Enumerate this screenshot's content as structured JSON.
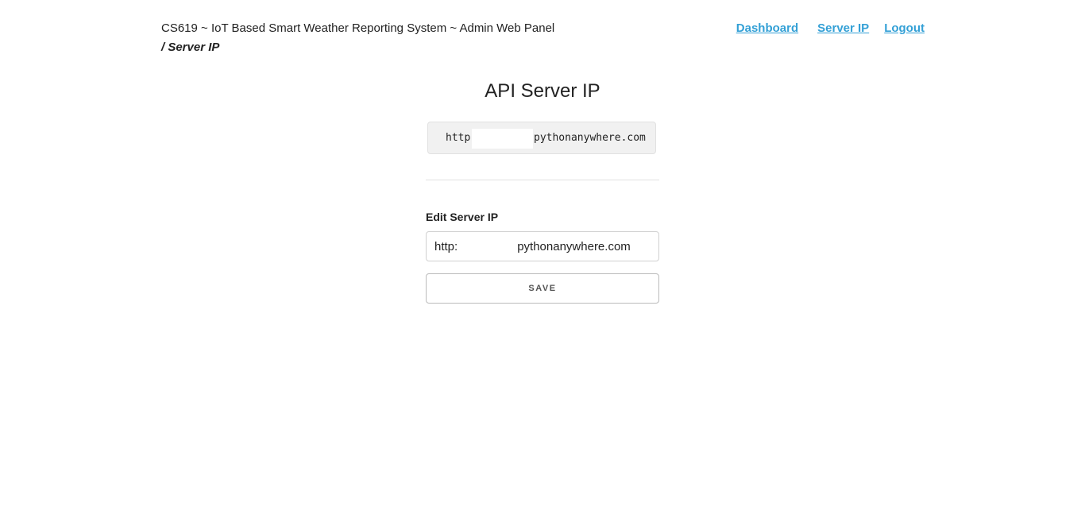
{
  "header": {
    "site_title": "CS619 ~ IoT Based Smart Weather Reporting System ~ Admin Web Panel",
    "breadcrumb": "/ Server IP",
    "nav": {
      "dashboard": "Dashboard",
      "server_ip": "Server IP",
      "logout": "Logout"
    },
    "link_color": "#33a0d6"
  },
  "main": {
    "title": "API Server IP",
    "current_ip": {
      "prefix": "http",
      "suffix": "pythonanywhere.com"
    },
    "edit": {
      "label": "Edit Server IP",
      "input_value": "http:                  pythonanywhere.com",
      "save_label": "Save"
    }
  }
}
